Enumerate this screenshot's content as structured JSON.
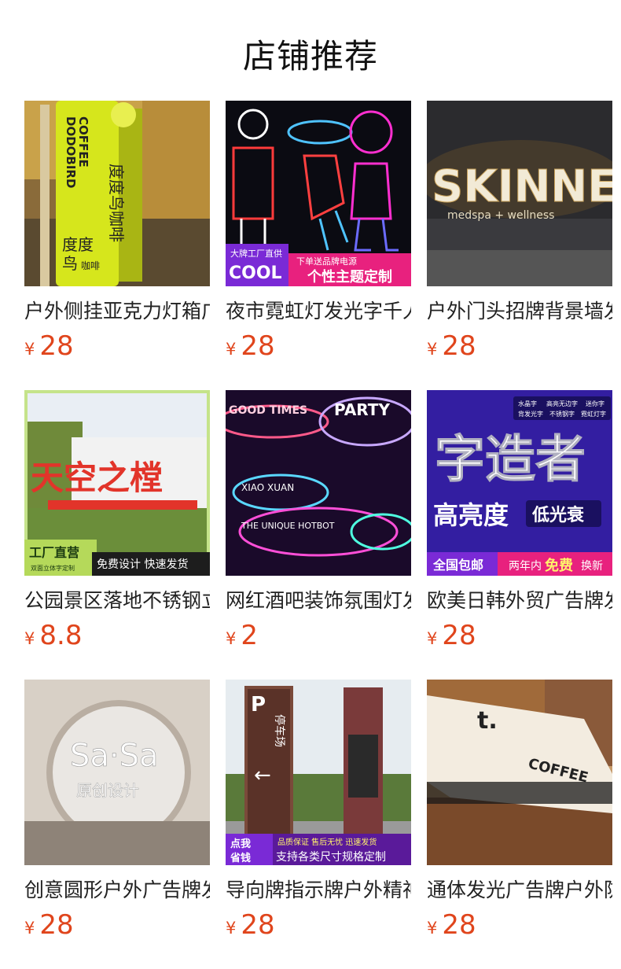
{
  "section": {
    "title": "店铺推荐"
  },
  "products": [
    {
      "name": "户外侧挂亚克力灯箱广告牌",
      "currency": "¥",
      "price": "28",
      "image_text": {
        "brand": "DODOBIRD",
        "sub": "COFFEE",
        "cn": "度度鸟咖啡",
        "cn_small": "度度",
        "cn_small2": "鸟",
        "cn_small3": "咖啡"
      }
    },
    {
      "name": "夜市霓虹灯发光字千人千面",
      "currency": "¥",
      "price": "28",
      "image_text": {
        "tag": "大牌工厂直供",
        "tag2": "COOL",
        "promo": "下单送品牌电源",
        "promo2": "个性主题定制"
      }
    },
    {
      "name": "户外门头招牌背景墙发光字",
      "currency": "¥",
      "price": "28",
      "image_text": {
        "brand": "SKINNEY",
        "sub": "medspa + wellness"
      }
    },
    {
      "name": "公园景区落地不锈钢立体字",
      "currency": "¥",
      "price": "8.8",
      "image_text": {
        "sign": "天空之樘",
        "tag": "工厂直营",
        "tag_sub": "双面立体字定制",
        "promo": "免费设计 快速发货"
      }
    },
    {
      "name": "网红酒吧装饰氛围灯发光字",
      "currency": "¥",
      "price": "2",
      "image_text": {
        "t1": "GOOD TIMES",
        "t2": "PARTY",
        "t3": "XIAO XUAN",
        "t4": "THE UNIQUE HOTBOT"
      }
    },
    {
      "name": "欧美日韩外贸广告牌发光字",
      "currency": "¥",
      "price": "28",
      "image_text": {
        "big": "字造者",
        "b1": "高亮度",
        "b2": "低光衰",
        "tags": [
          "水晶字",
          "高亮无边字",
          "迷你字",
          "背发光字",
          "不锈钢字",
          "霓虹灯字"
        ],
        "f1": "全国包邮",
        "f2": "两年内",
        "f3": "免费",
        "f4": "换新"
      }
    },
    {
      "name": "创意圆形户外广告牌发光字",
      "currency": "¥",
      "price": "28",
      "image_text": {
        "brand": "Sa·Sa",
        "sub": "原创设计"
      }
    },
    {
      "name": "导向牌指示牌户外精神堡垒",
      "currency": "¥",
      "price": "28",
      "image_text": {
        "p": "P",
        "park": "停车场",
        "b1": "点我",
        "b2": "省钱",
        "c1": "品质保证 售后无忧 迅速发货",
        "c2": "支持各类尺寸规格定制"
      }
    },
    {
      "name": "通体发光广告牌户外防水灯箱",
      "currency": "¥",
      "price": "28",
      "image_text": {
        "logo": "t.",
        "word": "COFFEE"
      }
    }
  ]
}
